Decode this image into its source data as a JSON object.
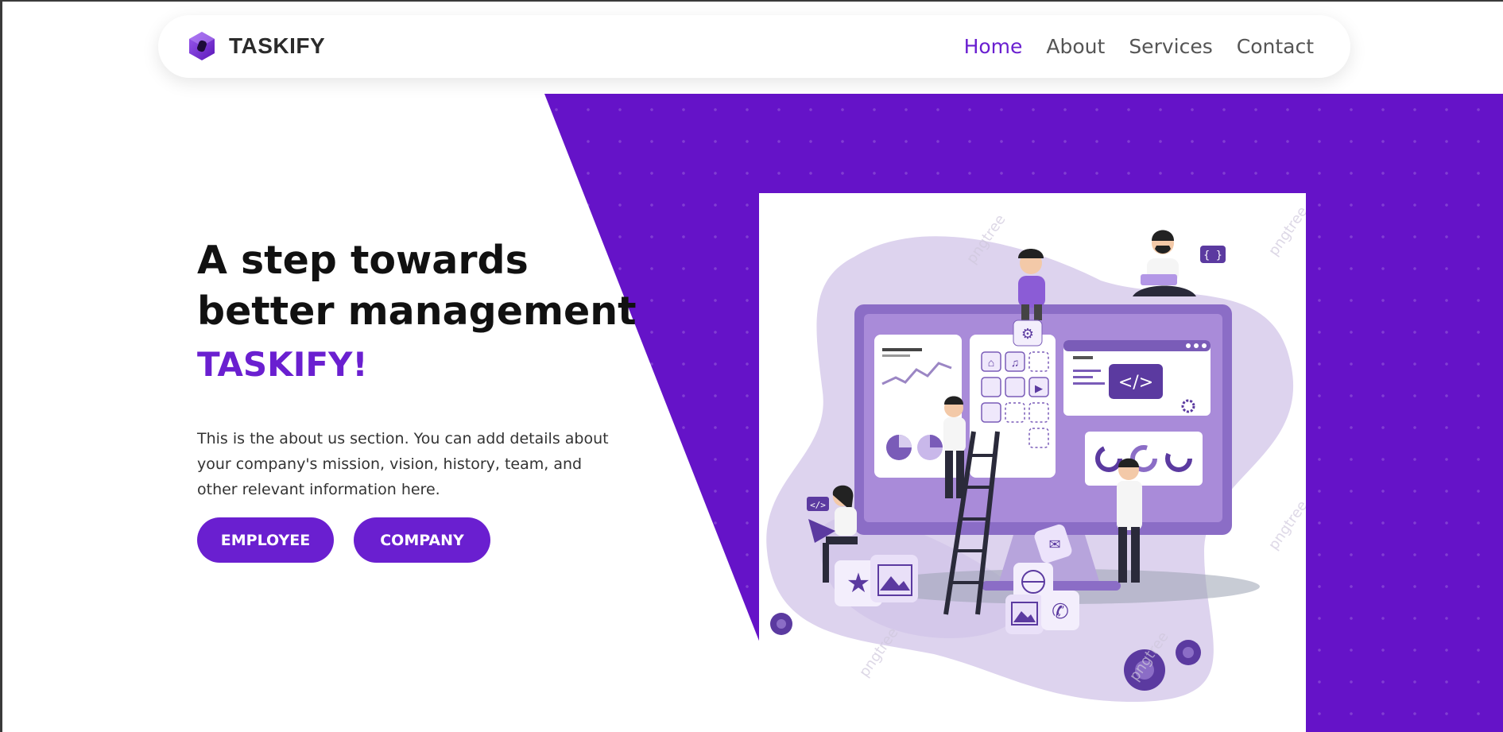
{
  "brand": {
    "name": "TASKIFY",
    "logo_icon": "hexagon-logo-icon"
  },
  "nav": {
    "items": [
      {
        "label": "Home",
        "active": true
      },
      {
        "label": "About",
        "active": false
      },
      {
        "label": "Services",
        "active": false
      },
      {
        "label": "Contact",
        "active": false
      }
    ]
  },
  "hero": {
    "headline_line1": "A step towards",
    "headline_line2": "better management",
    "accent": "TASKIFY!",
    "description": "This is the about us section. You can add details about your company's mission, vision, history, team, and other relevant information here.",
    "buttons": {
      "employee": "EMPLOYEE",
      "company": "COMPANY"
    }
  },
  "illustration": {
    "code_tag": "</>",
    "braces_tag": "{ }",
    "watermark": "pngtree"
  },
  "colors": {
    "accent": "#6a1fd0",
    "hero_bg": "#6513c8",
    "text_dark": "#111111"
  }
}
